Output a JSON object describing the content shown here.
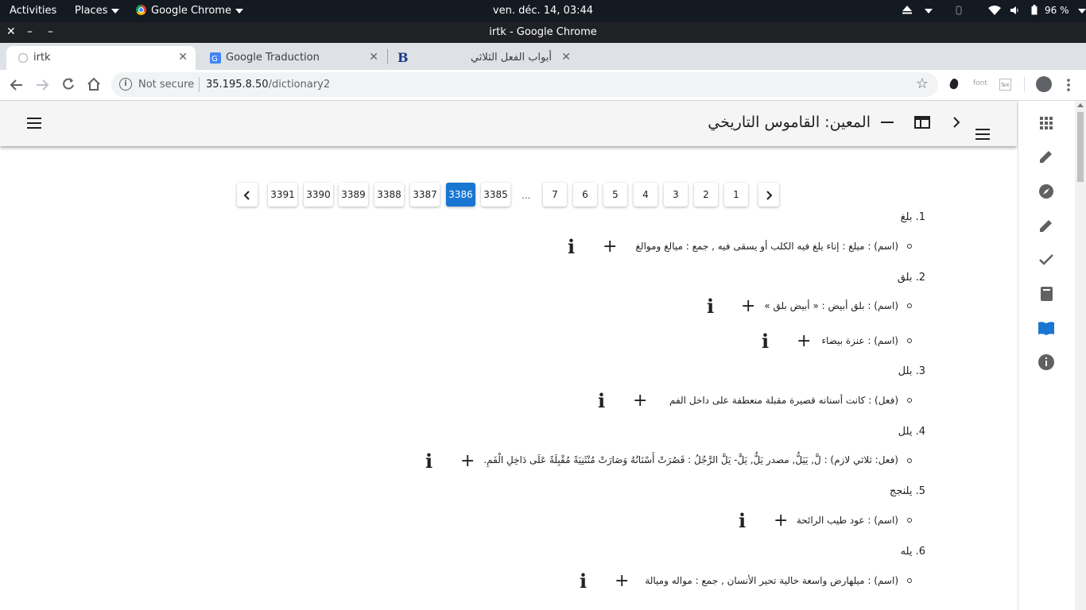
{
  "gnome": {
    "activities": "Activities",
    "places": "Places",
    "app_menu": "Google Chrome",
    "clock": "ven. déc. 14, 03:44",
    "battery": "96 %"
  },
  "window": {
    "title": "irtk - Google Chrome"
  },
  "tabs": [
    {
      "label": "irtk"
    },
    {
      "label": "Google Traduction"
    },
    {
      "label": "أبواب الفعل الثلاثي"
    }
  ],
  "toolbar": {
    "not_secure": "Not secure",
    "url_host": "35.195.8.50",
    "url_path": "/dictionary2",
    "ext_font": "font"
  },
  "app": {
    "title": "المعين: القاموس التاريخي"
  },
  "pagination": {
    "pages_left": [
      "3391",
      "3390",
      "3389",
      "3388",
      "3387",
      "3386",
      "3385"
    ],
    "ellipsis": "...",
    "pages_right": [
      "7",
      "6",
      "5",
      "4",
      "3",
      "2",
      "1"
    ],
    "active": "3386"
  },
  "entries": [
    {
      "head": "1. بلغ",
      "defs": [
        "(اسم) : ميلغ : إناء يلغ فيه الكلب أو يسقى فيه , جمع : ميالغ وموالغ"
      ]
    },
    {
      "head": "2. بلق",
      "defs": [
        "(اسم) : بلق أبيض : « أبيض بلق »",
        "(اسم) : عنزة بيضاء"
      ]
    },
    {
      "head": "3. بلل",
      "defs": [
        "(فعل) : كانت أسنانه قصيرة مقبلة منعطفة على داخل الفم"
      ]
    },
    {
      "head": "4. يلل",
      "defs": [
        "(فعل: ثلاثي لازم) : لَّ, يَيَلُّ, مصدر يَلٌّ, يَلَّ- يَلَّ الرَّجُلُ : قَصُرَتْ أَسْنَانُهُ وَصَارَتْ مُنْثَنِيَةً مُقْبِلَةً عَلَى دَاخِلِ الْفَمِ."
      ]
    },
    {
      "head": "5. يلنجج",
      "defs": [
        "(اسم) : عود طيب الرائحة"
      ]
    },
    {
      "head": "6. يله",
      "defs": [
        "(اسم) : ميلهارض واسعة خالية تحير الأنسان , جمع : مواله وميالة"
      ]
    }
  ]
}
